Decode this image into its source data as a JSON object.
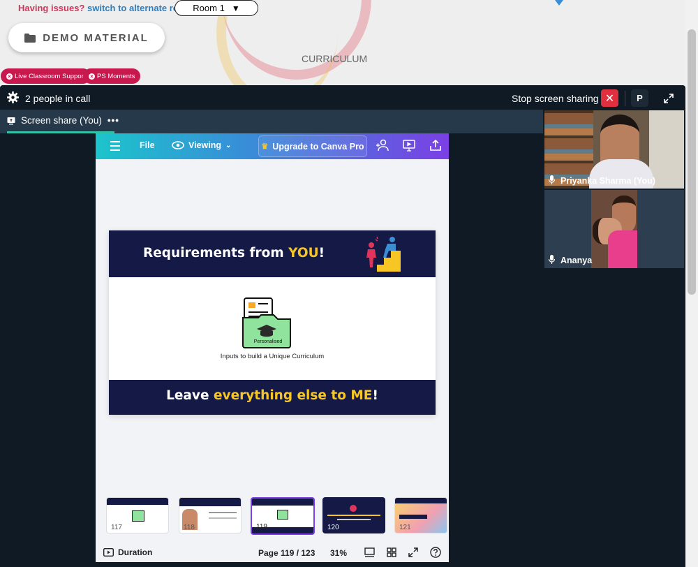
{
  "header": {
    "issues_text": "Having issues?",
    "alternate_link": "switch to alternate room",
    "room_select": "Room 1",
    "demo_button": "DEMO MATERIAL",
    "curriculum": "CURRICULUM",
    "pills": [
      "Live Classroom Support",
      "PS Moments"
    ]
  },
  "call": {
    "people_count": "2 people in call",
    "stop_sharing": "Stop screen sharing",
    "avatar_letter": "P",
    "tab_label": "Screen share (You)"
  },
  "canva": {
    "file": "File",
    "viewing": "Viewing",
    "upgrade": "Upgrade to Canva Pro",
    "slide": {
      "title_a": "Requirements from ",
      "title_b": "YOU",
      "title_c": "!",
      "folder_label": "Personalised",
      "caption": "Inputs to build a Unique Curriculum",
      "footer_a": "Leave ",
      "footer_b": "everything else to ME",
      "footer_c": "!"
    },
    "thumbnails": [
      "117",
      "118",
      "119",
      "120",
      "121"
    ],
    "duration": "Duration",
    "page": "Page 119 / 123",
    "zoom": "31%"
  },
  "participants": [
    {
      "name": "Priyanka Sharma (You)"
    },
    {
      "name": "Ananya"
    }
  ],
  "colors": {
    "accent": "#2fc2a6",
    "stop": "#e0303f",
    "slide_bg": "#141a45",
    "slide_yellow": "#f7c524"
  }
}
